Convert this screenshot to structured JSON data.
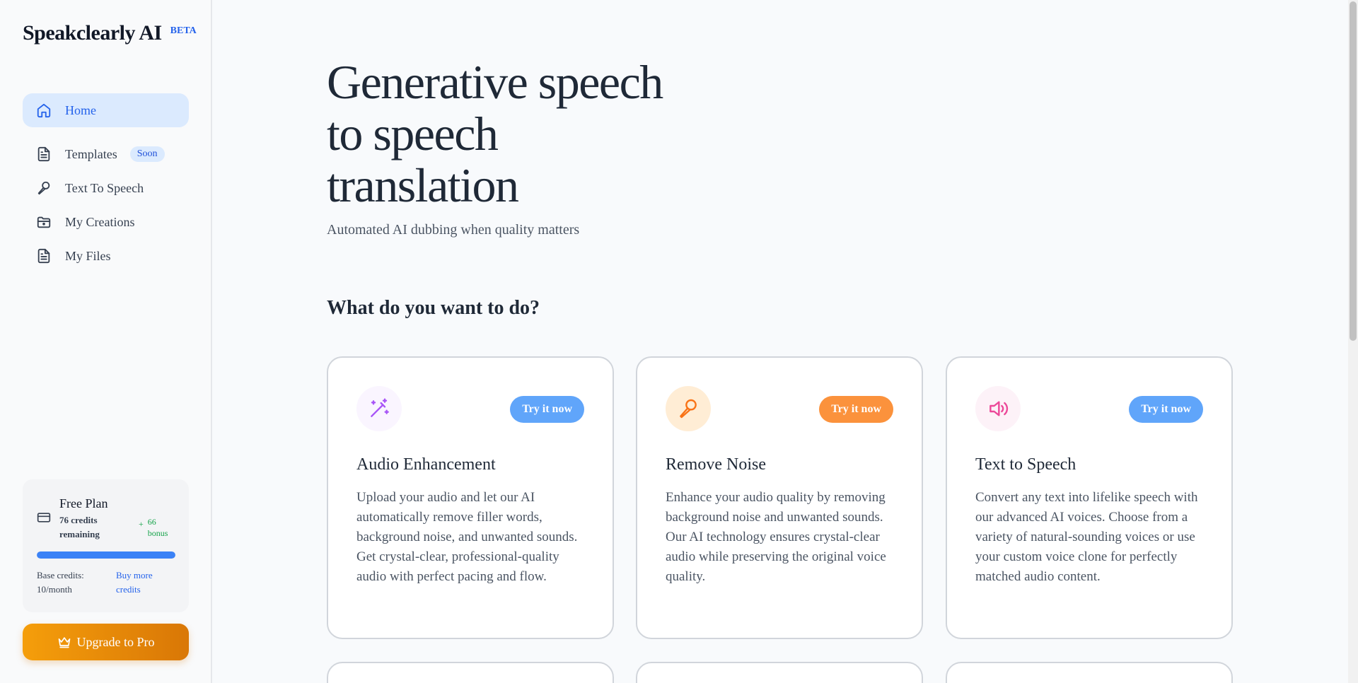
{
  "brand": {
    "name": "Speakclearly AI",
    "badge": "BETA"
  },
  "nav": {
    "home": "Home",
    "templates": "Templates",
    "templates_badge": "Soon",
    "text_to_speech": "Text To Speech",
    "my_creations": "My Creations",
    "my_files": "My Files"
  },
  "plan": {
    "title": "Free Plan",
    "credits": "76 credits remaining",
    "bonus_plus": "+",
    "bonus": "66 bonus",
    "progress": 1.0,
    "base": "Base credits: 10/month",
    "buy": "Buy more credits"
  },
  "upgrade": {
    "label": "Upgrade to Pro"
  },
  "hero": {
    "title": "Generative speech to speech translation",
    "subtitle": "Automated AI dubbing when quality matters"
  },
  "section": {
    "title": "What do you want to do?"
  },
  "cards": [
    {
      "icon": "magic-wand-icon",
      "cta": "Try it now",
      "title": "Audio Enhancement",
      "description": "Upload your audio and let our AI automatically remove filler words, background noise, and unwanted sounds. Get crystal-clear, professional-quality audio with perfect pacing and flow.",
      "accent": "#60a5fa",
      "icon_color": "#a855f7",
      "icon_bg": "#faf5ff"
    },
    {
      "icon": "microphone-icon",
      "cta": "Try it now",
      "title": "Remove Noise",
      "description": "Enhance your audio quality by removing background noise and unwanted sounds. Our AI technology ensures crystal-clear audio while preserving the original voice quality.",
      "accent": "#fb923c",
      "icon_color": "#f97316",
      "icon_bg": "#ffedd5"
    },
    {
      "icon": "speaker-icon",
      "cta": "Try it now",
      "title": "Text to Speech",
      "description": "Convert any text into lifelike speech with our advanced AI voices. Choose from a variety of natural-sounding voices or use your custom voice clone for perfectly matched audio content.",
      "accent": "#60a5fa",
      "icon_color": "#ec4899",
      "icon_bg": "#fdf2f8"
    }
  ]
}
